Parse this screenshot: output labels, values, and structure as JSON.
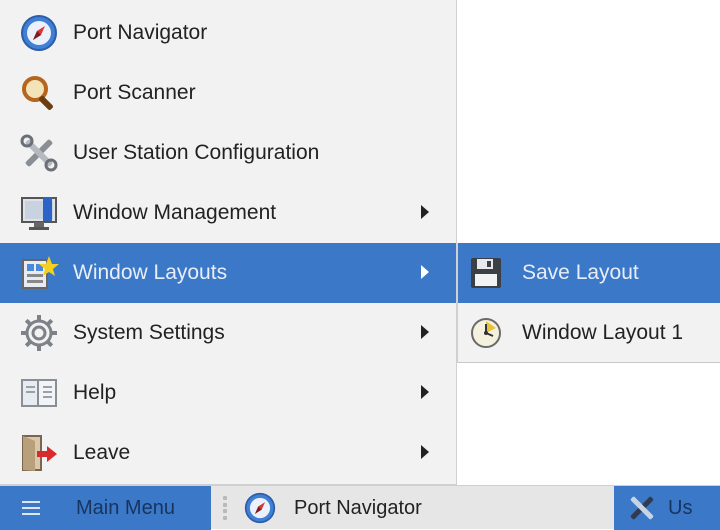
{
  "menu": {
    "items": [
      {
        "label": "Port Navigator",
        "icon": "compass-icon",
        "submenu": false
      },
      {
        "label": "Port Scanner",
        "icon": "magnifier-icon",
        "submenu": false
      },
      {
        "label": "User Station Configuration",
        "icon": "tools-icon",
        "submenu": false
      },
      {
        "label": "Window Management",
        "icon": "monitor-icon",
        "submenu": true
      },
      {
        "label": "Window Layouts",
        "icon": "layouts-icon",
        "submenu": true,
        "active": true
      },
      {
        "label": "System Settings",
        "icon": "gear-icon",
        "submenu": true
      },
      {
        "label": "Help",
        "icon": "help-book-icon",
        "submenu": true
      },
      {
        "label": "Leave",
        "icon": "exit-door-icon",
        "submenu": true
      }
    ]
  },
  "submenu": {
    "items": [
      {
        "label": "Save Layout",
        "icon": "floppy-disk-icon",
        "active": true
      },
      {
        "label": "Window Layout 1",
        "icon": "layout-clock-icon"
      }
    ]
  },
  "taskbar": {
    "main_menu_label": "Main Menu",
    "tasks": [
      {
        "label": "Port Navigator",
        "icon": "compass-icon"
      },
      {
        "label": "Us",
        "icon": "tools-icon"
      }
    ]
  },
  "colors": {
    "accent": "#3c78c8",
    "menu_bg": "#f2f2f2",
    "taskbar_bg": "#e6e6e6"
  }
}
